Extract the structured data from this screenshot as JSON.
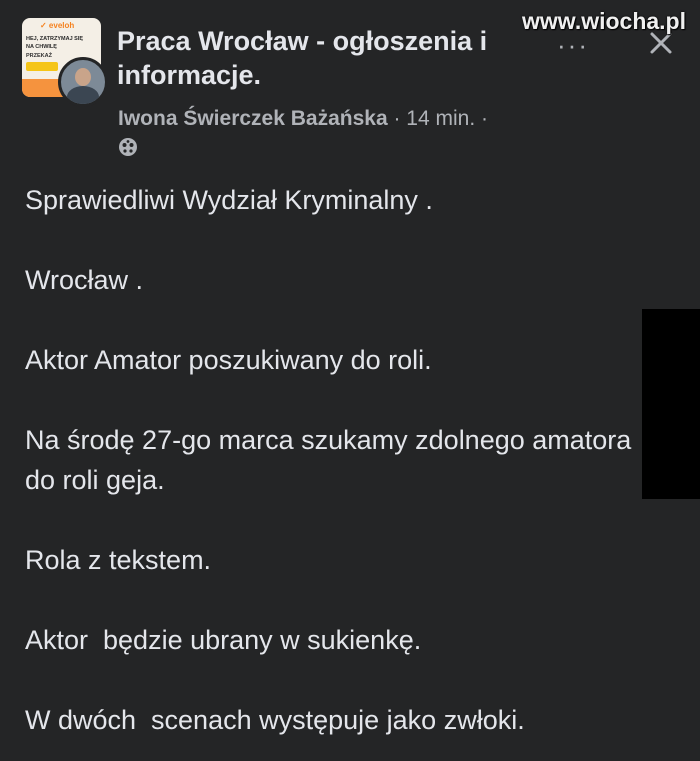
{
  "post": {
    "group_name": "Praca Wrocław - ogłoszenia i informacje.",
    "author": "Iwona Świerczek Bażańska",
    "time": "· 14 min. ·",
    "privacy_icon": "globe-icon",
    "group_thumbnail": {
      "logo_text": "✓ eveloh",
      "line1": "HEJ, ZATRZYMAJ SIĘ",
      "line2": "NA CHWILĘ",
      "line3": "PRZEKAŻ"
    },
    "paragraphs": [
      "Sprawiedliwi Wydział Kryminalny .",
      "Wrocław .",
      "Aktor Amator poszukiwany do roli.",
      "Na środę 27-go marca szukamy zdolnego amatora do roli geja.",
      "Rola z tekstem.",
      "Aktor  będzie ubrany w sukienkę.",
      "W dwóch  scenach występuje jako zwłoki."
    ]
  },
  "toolbar": {
    "more_icon": "more-icon",
    "close_icon": "close-icon"
  },
  "watermark": "www.wiocha.pl",
  "colors": {
    "background": "#242526",
    "text_primary": "#e4e6eb",
    "text_secondary": "#b0b3b8"
  }
}
